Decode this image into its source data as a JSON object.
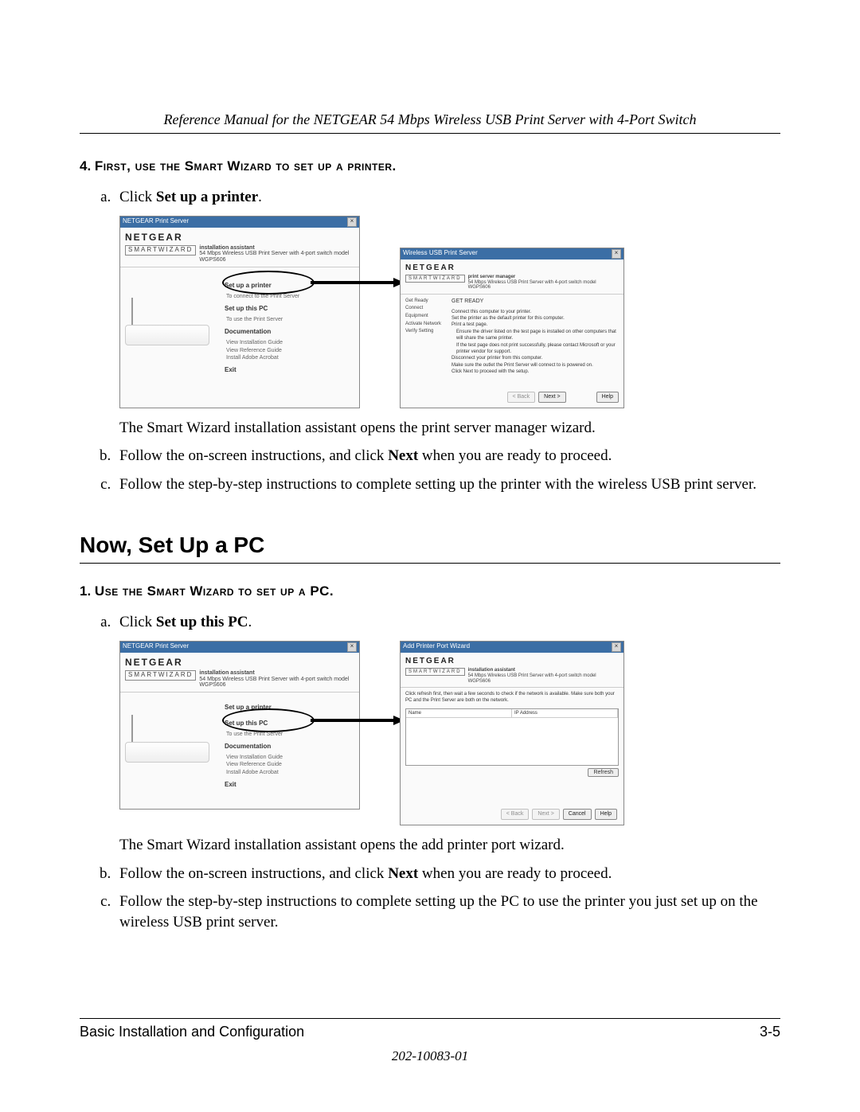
{
  "header": "Reference Manual for the NETGEAR 54 Mbps Wireless USB Print Server with 4-Port Switch",
  "section4": {
    "num": "4.",
    "title_sc": "First, use the Smart Wizard to set up a printer.",
    "a_prefix": "Click ",
    "a_bold": "Set up a printer",
    "a_suffix": ".",
    "after_fig": "The Smart Wizard installation assistant opens the print server manager wizard.",
    "b_prefix": "Follow the on-screen instructions, and click ",
    "b_bold": "Next",
    "b_suffix": " when you are ready to proceed.",
    "c": "Follow the step-by-step instructions to complete setting up the printer with the wireless USB print server."
  },
  "h2": "Now, Set Up a PC",
  "section1": {
    "num": "1.",
    "title_sc": "Use the Smart Wizard to set up a PC.",
    "a_prefix": "Click ",
    "a_bold": "Set up this PC",
    "a_suffix": ".",
    "after_fig": "The Smart Wizard installation assistant opens the add printer port wizard.",
    "b_prefix": "Follow the on-screen instructions, and click ",
    "b_bold": "Next",
    "b_suffix": " when you are ready to proceed.",
    "c": "Follow the step-by-step instructions to complete setting up the PC to use the printer you just set up on the wireless USB print server."
  },
  "fig_left": {
    "titlebar": "NETGEAR Print Server",
    "brand": "NETGEAR",
    "sw": "SMARTWIZARD",
    "sw_line1": "installation assistant",
    "sw_line2": "54 Mbps Wireless USB Print Server with 4-port switch model WGPS606",
    "m_setup_printer": "Set up a printer",
    "m_setup_printer_sub": "To connect to the Print Server",
    "m_setup_pc": "Set up this PC",
    "m_setup_pc_sub": "To use the Print Server",
    "m_doc": "Documentation",
    "m_doc1": "View Installation Guide",
    "m_doc2": "View Reference Guide",
    "m_doc3": "Install Adobe Acrobat",
    "m_exit": "Exit"
  },
  "fig_right1": {
    "titlebar": "Wireless USB Print Server",
    "brand": "NETGEAR",
    "sw": "SMARTWIZARD",
    "sw_line1": "print server manager",
    "sw_line2": "54 Mbps Wireless USB Print Server with 4-port switch model WGPS606",
    "nav1": "Get Ready",
    "nav2": "Connect Equipment",
    "nav3": "Activate Network",
    "nav4": "Verify Setting",
    "h": "GET READY",
    "l1": "Connect this computer to your printer.",
    "l2": "Set the printer as the default printer for this computer.",
    "l3": "Print a test page.",
    "l4": "Ensure the driver listed on the test page is installed on other computers that will share the same printer.",
    "l5": "If the test page does not print successfully, please contact Microsoft or your printer vendor for support.",
    "l6": "Disconnect your printer from this computer.",
    "l7": "Make sure the outlet the Print Server will connect to is powered on.",
    "l8": "Click Next to proceed with the setup.",
    "btn_back": "< Back",
    "btn_next": "Next >",
    "btn_help": "Help"
  },
  "fig_right2": {
    "titlebar": "Add Printer Port Wizard",
    "brand": "NETGEAR",
    "sw": "SMARTWIZARD",
    "sw_line1": "installation assistant",
    "sw_line2": "54 Mbps Wireless USB Print Server with 4-port switch model WGPS606",
    "instr": "Click refresh first, then wait a few seconds to check if the network is available. Make sure both your PC and the Print Server are both on the network.",
    "col1": "Name",
    "col2": "IP Address",
    "btn_refresh": "Refresh",
    "btn_back": "< Back",
    "btn_next": "Next >",
    "btn_cancel": "Cancel",
    "btn_help": "Help"
  },
  "footer": {
    "left": "Basic Installation and Configuration",
    "right": "3-5",
    "doc": "202-10083-01"
  }
}
